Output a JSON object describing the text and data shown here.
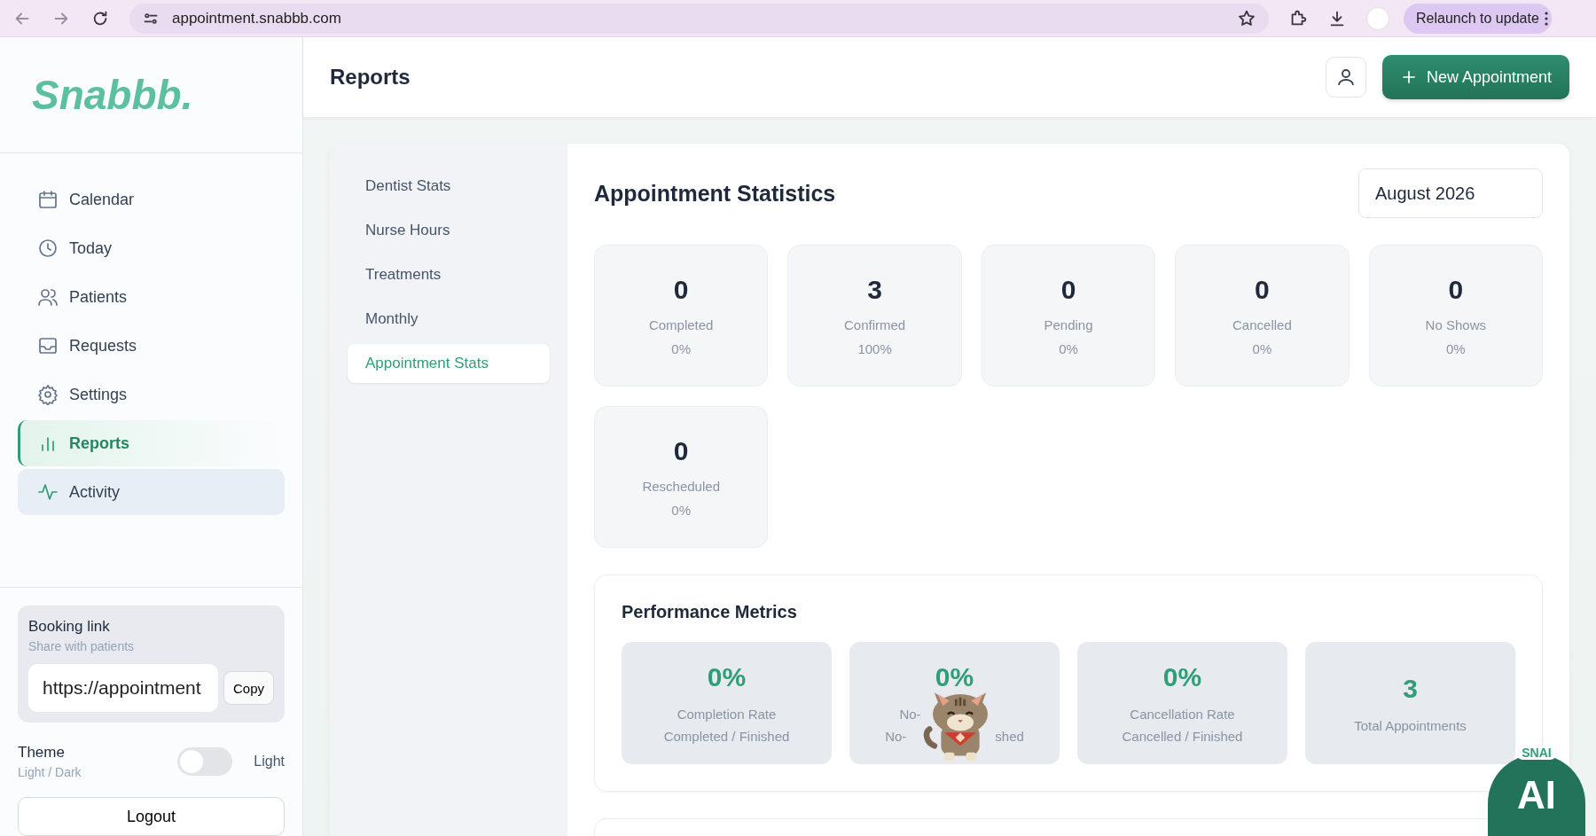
{
  "browser": {
    "url": "appointment.snabbb.com",
    "relaunch_button": "Relaunch to update"
  },
  "sidebar": {
    "logo": "Snabbb.",
    "items": [
      {
        "label": "Calendar",
        "kind": "calendar",
        "selected": false,
        "hovered": false
      },
      {
        "label": "Today",
        "kind": "clock",
        "selected": false,
        "hovered": false
      },
      {
        "label": "Patients",
        "kind": "people",
        "selected": false,
        "hovered": false
      },
      {
        "label": "Requests",
        "kind": "inbox",
        "selected": false,
        "hovered": false
      },
      {
        "label": "Settings",
        "kind": "gear",
        "selected": false,
        "hovered": false
      },
      {
        "label": "Reports",
        "kind": "bars",
        "selected": true,
        "hovered": false
      },
      {
        "label": "Activity",
        "kind": "pulse",
        "selected": false,
        "hovered": true
      }
    ],
    "booking_link": {
      "title": "Booking link",
      "subtitle": "Share with patients",
      "value": "https://appointment",
      "copy_button": "Copy"
    },
    "theme": {
      "label": "Theme",
      "subtitle": "Light / Dark",
      "on": false,
      "state_label": "Light"
    },
    "logout_button": "Logout"
  },
  "header": {
    "title": "Reports",
    "new_button": "New Appointment"
  },
  "report_menu": [
    {
      "label": "Dentist Stats",
      "selected": false
    },
    {
      "label": "Nurse Hours",
      "selected": false
    },
    {
      "label": "Treatments",
      "selected": false
    },
    {
      "label": "Monthly",
      "selected": false
    },
    {
      "label": "Appointment Stats",
      "selected": true
    }
  ],
  "statistics": {
    "title": "Appointment Statistics",
    "month": "August 2026",
    "cards": [
      {
        "value": "0",
        "label": "Completed",
        "percent": "0%"
      },
      {
        "value": "3",
        "label": "Confirmed",
        "percent": "100%"
      },
      {
        "value": "0",
        "label": "Pending",
        "percent": "0%"
      },
      {
        "value": "0",
        "label": "Cancelled",
        "percent": "0%"
      },
      {
        "value": "0",
        "label": "No Shows",
        "percent": "0%"
      },
      {
        "value": "0",
        "label": "Rescheduled",
        "percent": "0%"
      }
    ]
  },
  "performance": {
    "title": "Performance Metrics",
    "cards": [
      {
        "value": "0%",
        "label": "Completion Rate",
        "sublabel": "Completed / Finished",
        "mascot": false
      },
      {
        "value": "0%",
        "label": "No-",
        "sublabel": "No-",
        "sublabel_tail": "shed",
        "mascot": true
      },
      {
        "value": "0%",
        "label": "Cancellation Rate",
        "sublabel": "Cancelled / Finished",
        "mascot": false
      },
      {
        "value": "3",
        "label": "Total Appointments",
        "mascot": false
      }
    ]
  },
  "assistant": {
    "label": "SNAI",
    "text": "AI"
  }
}
